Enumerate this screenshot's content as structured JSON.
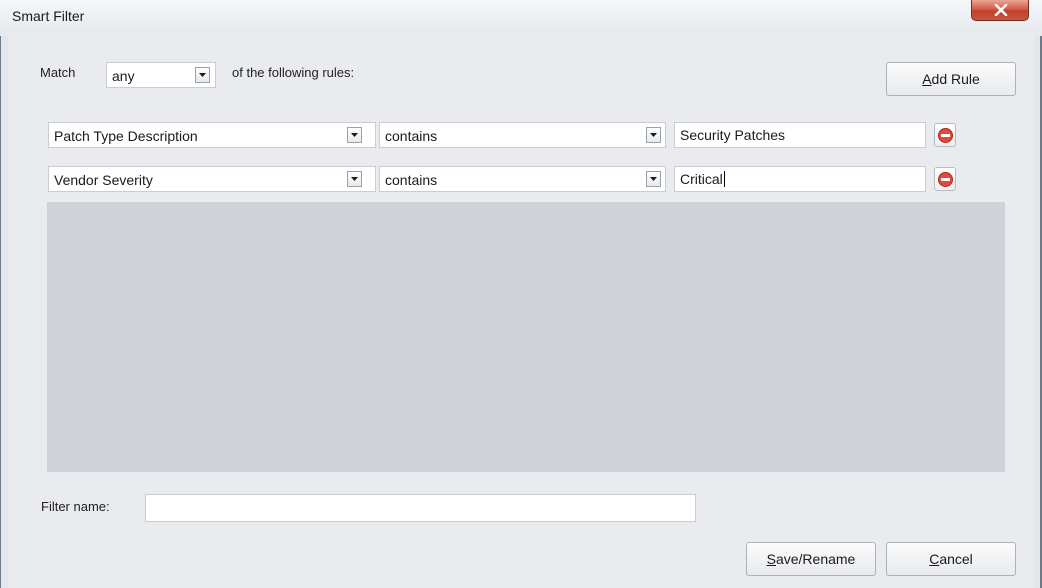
{
  "window": {
    "title": "Smart Filter"
  },
  "match": {
    "label": "Match",
    "selected": "any",
    "suffix": "of the following rules:"
  },
  "add_rule": {
    "mnemonic": "A",
    "rest": "dd Rule"
  },
  "rules": [
    {
      "field": "Patch Type Description",
      "operator": "contains",
      "value": "Security Patches"
    },
    {
      "field": "Vendor Severity",
      "operator": "contains",
      "value": "Critical"
    }
  ],
  "filter_name": {
    "label": "Filter name:",
    "value": ""
  },
  "buttons": {
    "save_mnemonic": "S",
    "save_rest": "ave/Rename",
    "cancel_mnemonic": "C",
    "cancel_rest": "ancel"
  },
  "icons": {
    "close": "close-x-icon",
    "dropdown": "chevron-down-icon",
    "remove": "remove-circle-icon"
  },
  "colors": {
    "close_button": "#c9553f",
    "remove_icon": "#e04a3c",
    "rules_area": "#cfd3d9"
  }
}
